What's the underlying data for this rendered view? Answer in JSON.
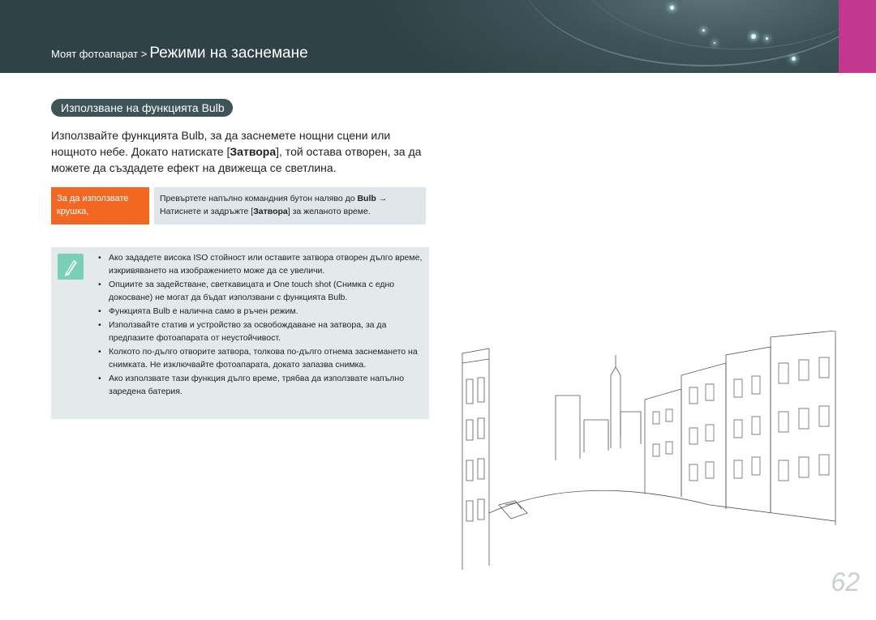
{
  "header": {
    "breadcrumb_small": "Моят фотоапарат >",
    "breadcrumb_large": "Режими на заснемане",
    "accent_color": "#c2378f",
    "bg_color": "#3f5459"
  },
  "section": {
    "title": "Използване на функцията Bulb",
    "intro_1": "Използвайте функцията Bulb, за да заснемете нощни сцени или нощното небе. Докато натискате [",
    "intro_bold": "Затвора",
    "intro_2": "], той остава отворен, за да можете да създадете ефект на движеща се светлина."
  },
  "howto": {
    "label": "За да използвате крушка,",
    "line1_a": "Превъртете напълно командния бутон наляво до ",
    "line1_bold": "Bulb",
    "line1_b": " →",
    "line2_a": "Натиснете и задръжте [",
    "line2_bold": "Затвора",
    "line2_b": "] за желаното време.",
    "label_color": "#f26722"
  },
  "notes": {
    "icon": "pencil-note-icon",
    "items": [
      "Ако зададете висока ISO стойност или оставите затвора отворен дълго време, изкривяването на изображението може да се увеличи.",
      "Опциите за задействане, светкавицата и One touch shot (Снимка с едно докосване) не могат да бъдат използвани с функцията Bulb.",
      "Функцията Bulb е налична само в ръчен режим.",
      "Използвайте статив и устройство за освобождаване на затвора, за да предпазите фотоапарата от неустойчивост.",
      "Колкото по-дълго отворите затвора, толкова по-дълго отнема заснемането на снимката. Не изключвайте фотоапарата, докато запазва снимка.",
      "Ако използвате тази функция дълго време, трябва да използвате напълно заредена батерия."
    ]
  },
  "page_number": "62"
}
